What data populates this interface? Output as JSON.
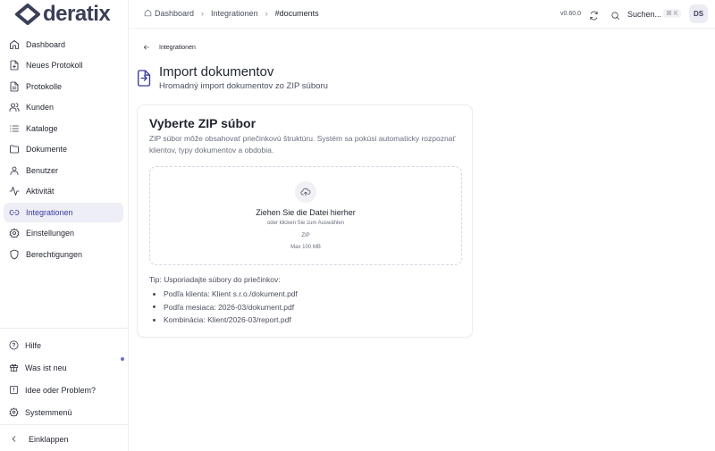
{
  "app": {
    "logo_text": "deratix"
  },
  "sidebar": {
    "items": [
      {
        "label": "Dashboard",
        "icon": "home-icon"
      },
      {
        "label": "Neues Protokoll",
        "icon": "file-plus-icon"
      },
      {
        "label": "Protokolle",
        "icon": "file-text-icon"
      },
      {
        "label": "Kunden",
        "icon": "users-icon"
      },
      {
        "label": "Kataloge",
        "icon": "list-icon"
      },
      {
        "label": "Dokumente",
        "icon": "folder-icon"
      },
      {
        "label": "Benutzer",
        "icon": "user-icon"
      },
      {
        "label": "Aktivität",
        "icon": "activity-icon"
      },
      {
        "label": "Integrationen",
        "icon": "link-icon",
        "active": true
      },
      {
        "label": "Einstellungen",
        "icon": "settings-icon"
      },
      {
        "label": "Berechtigungen",
        "icon": "shield-icon"
      }
    ],
    "bottom": {
      "help": "Hilfe",
      "whats_new": "Was ist neu",
      "feedback": "Idee oder Problem?",
      "system_menu": "Systemmenü",
      "collapse": "Einklappen"
    }
  },
  "header": {
    "breadcrumbs": [
      "Dashboard",
      "Integrationen",
      "#documents"
    ],
    "version": "v0.60.0",
    "search_label": "Suchen...",
    "shortcut": "⌘ K",
    "avatar_initials": "DS"
  },
  "page": {
    "back_label": "Integrationen",
    "title": "Import dokumentov",
    "subtitle": "Hromadný import dokumentov zo ZIP súboru"
  },
  "card": {
    "title": "Vyberte ZIP súbor",
    "description": "ZIP súbor môže obsahovať priečinkovú štruktúru. Systém sa pokúsi automaticky rozpoznať klientov, typy dokumentov a obdobia.",
    "dropzone": {
      "title": "Ziehen Sie die Datei hierher",
      "subtitle": "oder klicken Sie zum Auswählen",
      "format": "ZIP",
      "max_size": "Max 100 MB"
    },
    "tip_label": "Tip: Usporiadajte súbory do priečinkov:",
    "tips": [
      "Podľa klienta: Klient s.r.o./dokument.pdf",
      "Podľa mesiaca: 2026-03/dokument.pdf",
      "Kombinácia: Klient/2026-03/report.pdf"
    ]
  }
}
